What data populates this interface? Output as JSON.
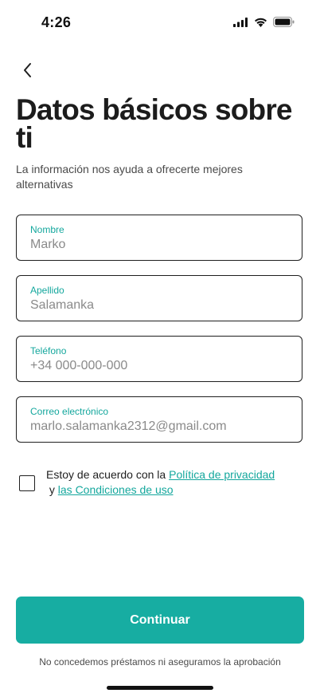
{
  "status_bar": {
    "time": "4:26",
    "icons": [
      "cellular-signal-icon",
      "wifi-icon",
      "battery-icon"
    ]
  },
  "header": {
    "back_icon": "chevron-left-icon",
    "title": "Datos básicos sobre ti",
    "subtitle": "La información nos ayuda a ofrecerte mejores alternativas"
  },
  "form": {
    "first_name": {
      "label": "Nombre",
      "placeholder": "Marko"
    },
    "last_name": {
      "label": "Apellido",
      "placeholder": "Salamanka"
    },
    "phone": {
      "label": "Teléfono",
      "placeholder": "+34 000-000-000"
    },
    "email": {
      "label": "Correo electrónico",
      "placeholder": "marlo.salamanka2312@gmail.com"
    }
  },
  "consent": {
    "checked": false,
    "text_before": "Estoy de acuerdo con la ",
    "privacy_link": "Política de privacidad",
    "text_middle": " y ",
    "terms_link": "las Condiciones de uso"
  },
  "footer": {
    "continue_label": "Continuar",
    "disclaimer": "No concedemos préstamos ni aseguramos la aprobación"
  },
  "colors": {
    "accent": "#17ada2",
    "label": "#14a79d",
    "text": "#1f1f1f",
    "muted": "#8a8a8a"
  }
}
